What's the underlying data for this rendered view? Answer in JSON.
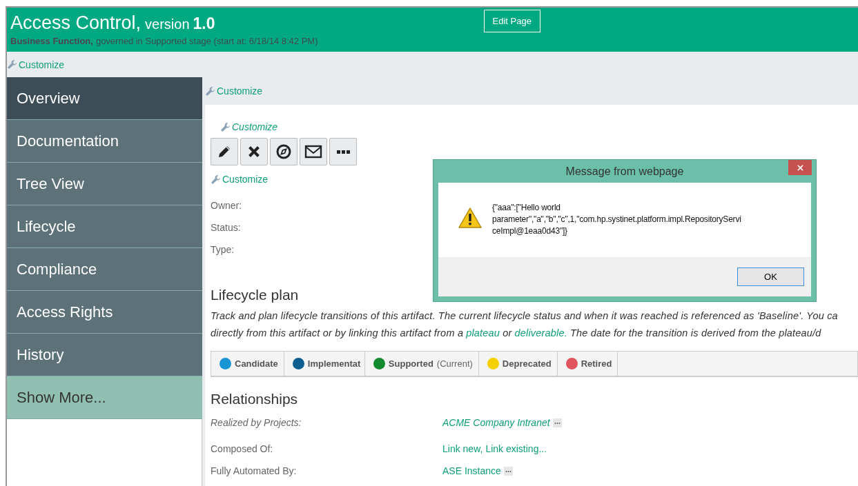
{
  "header": {
    "title": "Access Control,",
    "version_label": "version",
    "version": "1.0",
    "subtitle_bold": "Business Function,",
    "subtitle": "governed in Supported stage (start at: 6/18/14 8:42 PM)",
    "edit_button": "Edit Page"
  },
  "top_customize": "Customize",
  "sidebar": {
    "items": [
      {
        "label": "Overview",
        "selected": true,
        "kind": "nav"
      },
      {
        "label": "Documentation",
        "selected": false,
        "kind": "nav"
      },
      {
        "label": "Tree View",
        "selected": false,
        "kind": "nav"
      },
      {
        "label": "Lifecycle",
        "selected": false,
        "kind": "nav"
      },
      {
        "label": "Compliance",
        "selected": false,
        "kind": "nav"
      },
      {
        "label": "Access Rights",
        "selected": false,
        "kind": "nav"
      },
      {
        "label": "History",
        "selected": false,
        "kind": "nav"
      },
      {
        "label": "Show More...",
        "selected": false,
        "kind": "more"
      }
    ]
  },
  "main_customize": "Customize",
  "panel_customize": "Customize",
  "toolbar": [
    {
      "kind": "edit"
    },
    {
      "kind": "delete"
    },
    {
      "kind": "compass"
    },
    {
      "kind": "mail"
    },
    {
      "kind": "more"
    }
  ],
  "info_customize": "Customize",
  "fields": [
    {
      "label": "Owner:"
    },
    {
      "label": "Status:"
    },
    {
      "label": "Type:"
    }
  ],
  "lifecycle": {
    "title": "Lifecycle plan",
    "line_1": "Track and plan lifecycle transitions of this artifact. The current lifecycle status and when it was reached is referenced as 'Baseline'. You ca",
    "line_2_start": "directly from this artifact or by linking this artifact from a",
    "link_1": "plateau",
    "line_2_mid": "or",
    "link_2": "deliverable.",
    "line_2_end": "The date for the transition is derived from the plateau/d",
    "stages": [
      {
        "label": "Candidate",
        "color": "#1a96d4"
      },
      {
        "label": "Implementat",
        "color": "#0e5f91"
      },
      {
        "label": "Supported",
        "color": "#138a2e",
        "note": "(Current)"
      },
      {
        "label": "Deprecated",
        "color": "#f5d000"
      },
      {
        "label": "Retired",
        "color": "#e0545e"
      }
    ]
  },
  "relationships": {
    "title": "Relationships",
    "rows": [
      {
        "label": "Realized by Projects:",
        "italic": true,
        "links": [
          "ACME Company Intranet"
        ],
        "more": true
      },
      {
        "label": "Composed Of:",
        "italic": false,
        "links": [
          "Link new,",
          "Link existing..."
        ],
        "more": false
      },
      {
        "label": "Fully Automated By:",
        "italic": false,
        "links": [
          "ASE Instance"
        ],
        "more": true
      }
    ]
  },
  "dialog": {
    "title": "Message from webpage",
    "message_lines": [
      "{\"aaa\":[\"Hello world",
      "parameter\",\"a\",\"b\",\"c\",1,\"com.hp.systinet.platform.impl.RepositoryServi",
      "ceImpl@1eaa0d43\"]}"
    ],
    "ok": "OK"
  }
}
